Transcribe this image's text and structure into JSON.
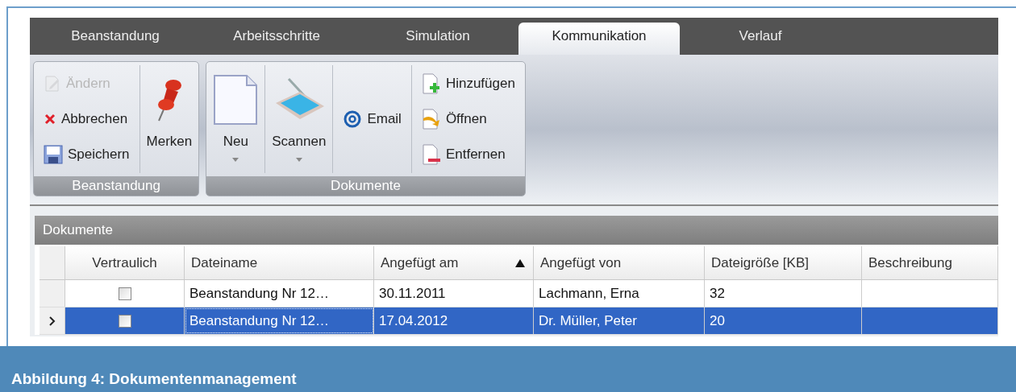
{
  "tabs": [
    {
      "label": "Beanstandung",
      "selected": false
    },
    {
      "label": "Arbeitsschritte",
      "selected": false
    },
    {
      "label": "Simulation",
      "selected": false
    },
    {
      "label": "Kommunikation",
      "selected": true
    },
    {
      "label": "Verlauf",
      "selected": false
    }
  ],
  "ribbon_groups": [
    {
      "label": "Beanstandung",
      "columns": [
        {
          "kind": "stack",
          "items": [
            {
              "label": "Ändern",
              "disabled": true
            },
            {
              "label": "Abbrechen",
              "disabled": false
            },
            {
              "label": "Speichern",
              "disabled": false
            }
          ]
        },
        {
          "kind": "large",
          "label": "Merken",
          "dropdown": false
        }
      ]
    },
    {
      "label": "Dokumente",
      "columns": [
        {
          "kind": "large",
          "label": "Neu",
          "dropdown": true
        },
        {
          "kind": "large",
          "label": "Scannen",
          "dropdown": true
        },
        {
          "kind": "stack",
          "items": [
            {
              "label": "Email",
              "disabled": false
            }
          ]
        },
        {
          "kind": "stack",
          "items": [
            {
              "label": "Hinzufügen",
              "disabled": false
            },
            {
              "label": "Öffnen",
              "disabled": false
            },
            {
              "label": "Entfernen",
              "disabled": false
            }
          ]
        }
      ]
    }
  ],
  "grid": {
    "title": "Dokumente",
    "columns": [
      {
        "label": "Vertraulich",
        "sorted": false
      },
      {
        "label": "Dateiname",
        "sorted": false
      },
      {
        "label": "Angefügt am",
        "sorted": true
      },
      {
        "label": "Angefügt von",
        "sorted": false
      },
      {
        "label": "Dateigröße [KB]",
        "sorted": false
      },
      {
        "label": "Beschreibung",
        "sorted": false
      }
    ],
    "rows": [
      {
        "selected": false,
        "current": false,
        "cells": [
          {
            "kind": "checkbox",
            "checked": false
          },
          "Beanstandung Nr 12…",
          "30.11.2011",
          "Lachmann, Erna",
          "32"
        ]
      },
      {
        "selected": true,
        "current": true,
        "cells": [
          {
            "kind": "checkbox",
            "checked": false
          },
          "Beanstandung Nr 12…",
          "17.04.2012",
          "Dr. Müller, Peter",
          "20"
        ]
      }
    ]
  },
  "caption": "Abbildung 4: Dokumentenmanagement"
}
